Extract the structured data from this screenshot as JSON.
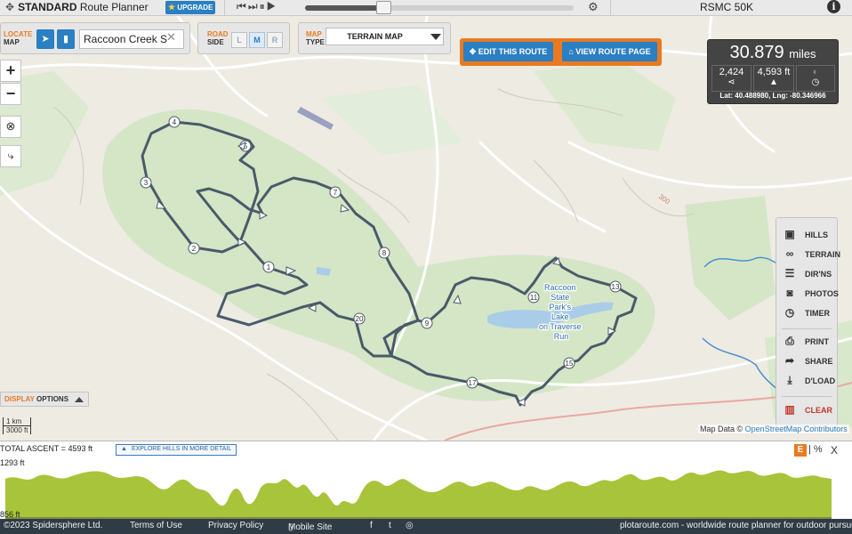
{
  "topbar": {
    "app_icon": "crosshair-icon",
    "title_bold": "STANDARD",
    "title_rest": "Route Planner",
    "upgrade_label": "UPGRADE",
    "playback_controls": [
      "skip-back-icon",
      "step-icon",
      "pause-icon",
      "play-icon"
    ],
    "playback_progress": 0.29,
    "settings_icon": "gear-icon",
    "route_name": "RSMC 50K",
    "info_icon": "info-icon"
  },
  "locate": {
    "label_top": "LOCATE",
    "label_bottom": "MAP",
    "value": "Raccoon Creek S",
    "clear_icon": "x-icon"
  },
  "road_side": {
    "label_top": "ROAD",
    "label_bottom": "SIDE",
    "options": [
      "L",
      "M",
      "R"
    ],
    "selected": "M"
  },
  "map_type": {
    "label_top": "MAP",
    "label_bottom": "TYPE",
    "selected": "TERRAIN MAP"
  },
  "actions": {
    "edit_label": "EDIT THIS ROUTE",
    "view_label": "VIEW ROUTE PAGE"
  },
  "stats": {
    "distance": "30.879",
    "distance_unit": "miles",
    "points": "2,424",
    "ascent": "4,593 ft",
    "latlng": "Lat: 40.488980, Lng: -80.346966"
  },
  "right_tools": [
    {
      "icon": "image-icon",
      "label": "HILLS"
    },
    {
      "icon": "binoculars-icon",
      "label": "TERRAIN"
    },
    {
      "icon": "list-icon",
      "label": "DIR'NS"
    },
    {
      "icon": "camera-icon",
      "label": "PHOTOS"
    },
    {
      "icon": "clock-icon",
      "label": "TIMER"
    },
    {
      "icon": "print-icon",
      "label": "PRINT"
    },
    {
      "icon": "share-icon",
      "label": "SHARE"
    },
    {
      "icon": "download-icon",
      "label": "D'LOAD"
    },
    {
      "icon": "trash-icon",
      "label": "CLEAR"
    }
  ],
  "display_options": {
    "label_orange": "DISPLAY",
    "label_rest": "OPTIONS"
  },
  "scale": {
    "km": "1 km",
    "ft": "3000 ft"
  },
  "attribution": {
    "prefix": "Map Data ©",
    "link": "OpenStreetMap Contributors"
  },
  "map_labels": {
    "lake": [
      "Raccoon",
      "State",
      "Park's",
      "Lake",
      "on Traverse",
      "Run"
    ],
    "road_number": "300"
  },
  "mile_markers": [
    "1",
    "2",
    "3",
    "4",
    "5",
    "7",
    "8",
    "9",
    "11",
    "13",
    "15",
    "17",
    "20"
  ],
  "elevation": {
    "total_ascent": "TOTAL ASCENT = 4593 ft",
    "explore_label": "EXPLORE HILLS IN MORE DETAIL",
    "max": "1293 ft",
    "min": "856 ft",
    "e_label": "E",
    "pct_label": "| %",
    "close_label": "X"
  },
  "footer": {
    "copyright": "©2023 Spidersphere Ltd.",
    "terms": "Terms of Use",
    "privacy": "Privacy Policy",
    "mobile": "Mobile Site",
    "tagline": "plotaroute.com - worldwide route planner for outdoor pursuits"
  },
  "colors": {
    "accent_blue": "#2b7fc3",
    "accent_orange": "#ea7a22",
    "route": "#4a5a6a",
    "elevation_fill": "#a8c43a",
    "park_green": "#cfe3c0",
    "water": "#a9cde8"
  }
}
